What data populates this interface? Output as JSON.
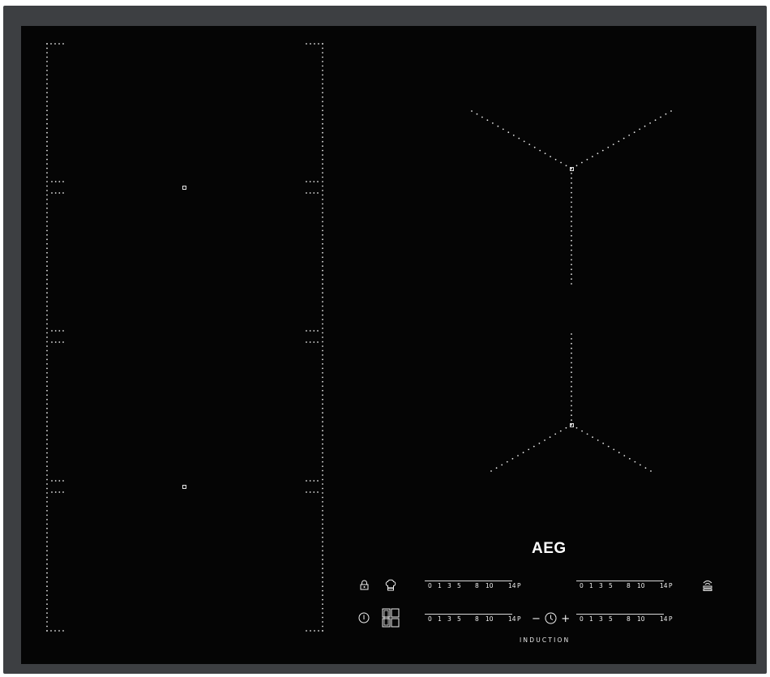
{
  "brand": {
    "logo": "AEG",
    "subtitle": "INDUCTION"
  },
  "colors": {
    "frame": "#3d3f42",
    "glass": "#050505",
    "markings": "#f0f0f0"
  },
  "power_scale": [
    "0",
    "1",
    "3",
    "5",
    "8",
    "10",
    "14",
    "P"
  ],
  "controls": {
    "timer": {
      "minus": "−",
      "plus": "+"
    },
    "icons": [
      "lock-icon",
      "chef-hat-icon",
      "power-icon",
      "bridge-zones-icon",
      "hob-to-hood-icon",
      "clock-icon"
    ]
  }
}
